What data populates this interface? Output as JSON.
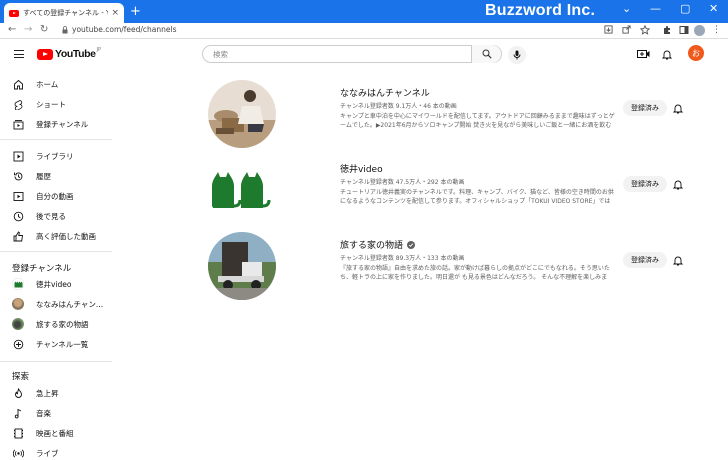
{
  "browser": {
    "tab_title": "すべての登録チャンネル - YouTube",
    "tab_close": "×",
    "new_tab": "+",
    "brand": "Buzzword Inc.",
    "window_controls": [
      "⌄",
      "—",
      "▢",
      "✕"
    ],
    "nav": {
      "back": "←",
      "forward": "→",
      "reload": "↻"
    },
    "url": "youtube.com/feed/channels"
  },
  "header": {
    "logo_text": "YouTube",
    "logo_region": "JP",
    "search_placeholder": "検索",
    "avatar_letter": "お"
  },
  "sidebar": {
    "main": [
      {
        "label": "ホーム",
        "icon": "home-icon"
      },
      {
        "label": "ショート",
        "icon": "shorts-icon"
      },
      {
        "label": "登録チャンネル",
        "icon": "subscriptions-icon"
      }
    ],
    "library": [
      {
        "label": "ライブラリ",
        "icon": "library-icon"
      },
      {
        "label": "履歴",
        "icon": "history-icon"
      },
      {
        "label": "自分の動画",
        "icon": "my-videos-icon"
      },
      {
        "label": "後で見る",
        "icon": "watch-later-icon"
      },
      {
        "label": "高く評価した動画",
        "icon": "liked-icon"
      }
    ],
    "subscriptions_heading": "登録チャンネル",
    "subscriptions": [
      {
        "label": "徳井video"
      },
      {
        "label": "ななみはんチャン..."
      },
      {
        "label": "旅する家の物語"
      },
      {
        "label": "チャンネル一覧",
        "icon": "channel-list-icon"
      }
    ],
    "explore_heading": "探索",
    "explore": [
      {
        "label": "急上昇",
        "icon": "trending-icon"
      },
      {
        "label": "音楽",
        "icon": "music-icon"
      },
      {
        "label": "映画と番組",
        "icon": "movies-icon"
      },
      {
        "label": "ライブ",
        "icon": "live-icon"
      }
    ]
  },
  "channels": [
    {
      "name": "ななみはんチャンネル",
      "meta": "チャンネル登録者数 9.1万人・46 本の動画",
      "desc": "キャンプと車中泊を中心にマイワールドを配信してます。アウトドアに回顧みるままで趣味はずっとゲームでした。▶2021年6月からソロキャンプ開始 焚き火を見ながら美味しいご飯と一緒にお酒を飲む",
      "subscribed_label": "登録済み",
      "verified": false
    },
    {
      "name": "徳井video",
      "meta": "チャンネル登録者数 47.5万人・292 本の動画",
      "desc": "チュートリアル徳井義実のチャンネルです。料理、キャンプ、バイク、猫など、皆様の空き時間のお供になるようなコンテンツを配信して参ります。オフィシャルショップ「TOKUI VIDEO STORE」では",
      "subscribed_label": "登録済み",
      "verified": false
    },
    {
      "name": "旅する家の物語",
      "meta": "チャンネル登録者数 89.3万人・133 本の動画",
      "desc": "『旅する家の物語』自由を求めた旅の話。家が動けば暮らしの拠点がどこにでもなれる。そう思いたち、軽トラの上に家を作りました。明日還が も見る景色はどんなだろう。 そんな不理解を楽しみま",
      "subscribed_label": "登録済み",
      "verified": true
    }
  ],
  "colors": {
    "chrome_blue": "#1a73e8",
    "yt_red": "#ff0000",
    "avatar_orange": "#ef5a1c",
    "cat_green": "#1e7a2c"
  }
}
